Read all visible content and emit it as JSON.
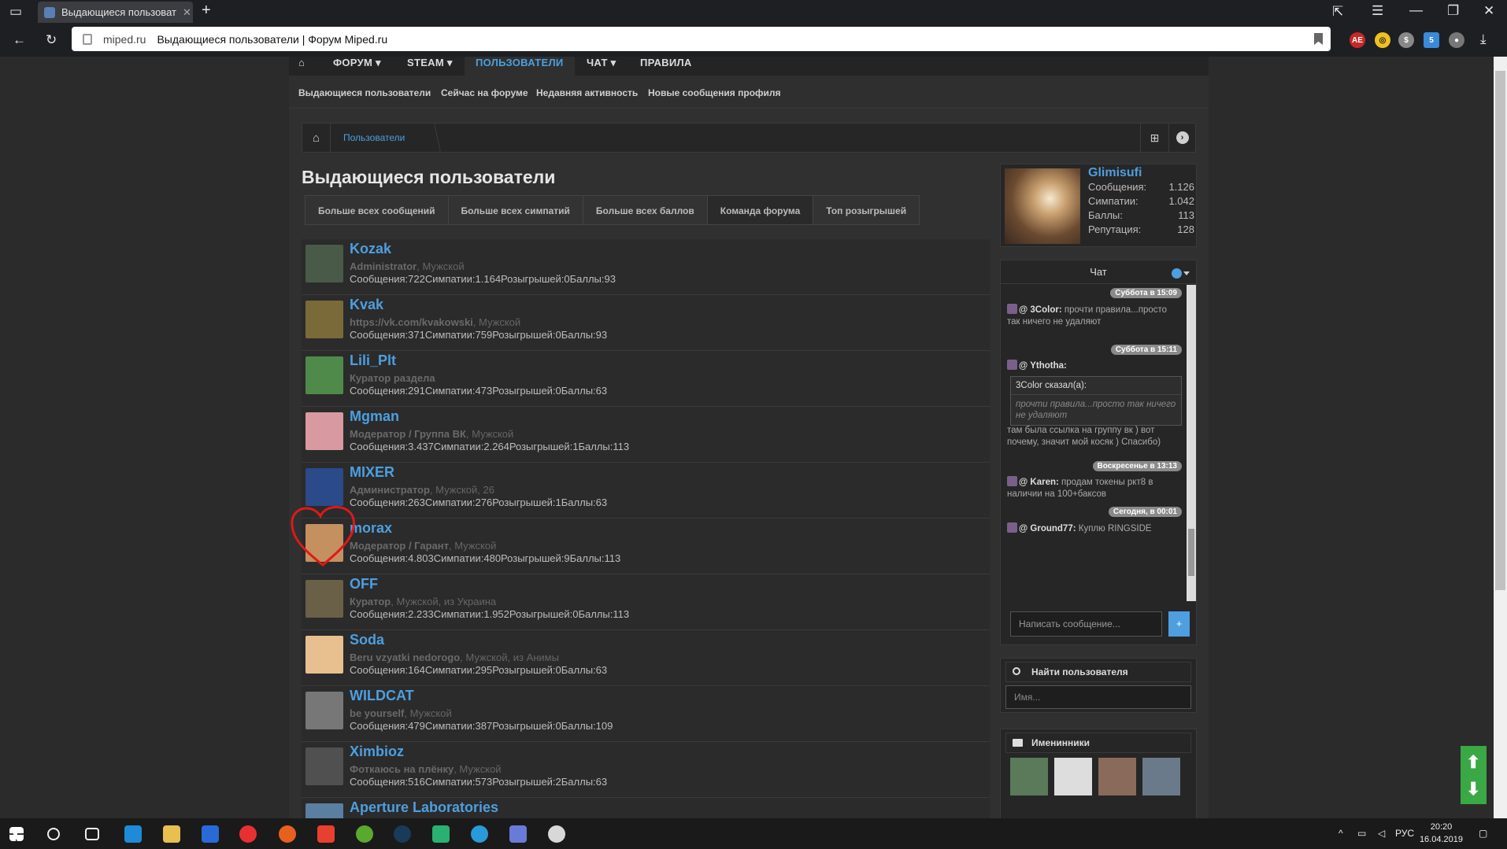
{
  "browser": {
    "tab_title": "Выдающиеся пользоват",
    "domain": "miped.ru",
    "page_title": "Выдающиеся пользователи | Форум Miped.ru"
  },
  "nav": {
    "forum": "ФОРУМ ▾",
    "steam": "STEAM ▾",
    "users": "ПОЛЬЗОВАТЕЛИ",
    "chat": "ЧАТ ▾",
    "rules": "ПРАВИЛА"
  },
  "subnav": [
    "Выдающиеся пользователи",
    "Сейчас на форуме",
    "Недавняя активность",
    "Новые сообщения профиля"
  ],
  "breadcrumb": {
    "item": "Пользователи"
  },
  "page_heading": "Выдающиеся пользователи",
  "tabs": [
    "Больше всех сообщений",
    "Больше всех симпатий",
    "Больше всех баллов",
    "Команда форума",
    "Топ розыгрышей"
  ],
  "members": [
    {
      "name": "Kozak",
      "title": "Administrator",
      "extra": ", Мужской",
      "stats": "Сообщения:722Симпатии:1.164Розыгрышей:0Баллы:93",
      "color": "#4a5a48"
    },
    {
      "name": "Kvak",
      "title": "https://vk.com/kvakowski",
      "extra": ", Мужской",
      "stats": "Сообщения:371Симпатии:759Розыгрышей:0Баллы:93",
      "color": "#7a6a3a"
    },
    {
      "name": "Lili_Plt",
      "title": "Куратор раздела",
      "extra": "",
      "stats": "Сообщения:291Симпатии:473Розыгрышей:0Баллы:63",
      "color": "#4f8a4a"
    },
    {
      "name": "Mgman",
      "title": "Модератор / Группа ВК",
      "extra": ", Мужской",
      "stats": "Сообщения:3.437Симпатии:2.264Розыгрышей:1Баллы:113",
      "color": "#d89aa0"
    },
    {
      "name": "MIXER",
      "title": "Администратор",
      "extra": ", Мужской, 26",
      "stats": "Сообщения:263Симпатии:276Розыгрышей:1Баллы:63",
      "color": "#2a4a8a"
    },
    {
      "name": "morax",
      "title": "Модератор / Гарант",
      "extra": ", Мужской",
      "stats": "Сообщения:4.803Симпатии:480Розыгрышей:9Баллы:113",
      "color": "#c49060"
    },
    {
      "name": "OFF",
      "title": "Куратор",
      "extra": ", Мужской, из Украина",
      "stats": "Сообщения:2.233Симпатии:1.952Розыгрышей:0Баллы:113",
      "color": "#6a6048"
    },
    {
      "name": "Soda",
      "title": "Beru vzyatki nedorogo",
      "extra": ", Мужской, из Анимы",
      "stats": "Сообщения:164Симпатии:295Розыгрышей:0Баллы:63",
      "color": "#e8c090"
    },
    {
      "name": "WILDCAT",
      "title": "be yourself",
      "extra": ", Мужской",
      "stats": "Сообщения:479Симпатии:387Розыгрышей:0Баллы:109",
      "color": "#777777"
    },
    {
      "name": "Ximbioz",
      "title": "Фоткаюсь на плёнку",
      "extra": ", Мужской",
      "stats": "Сообщения:516Симпатии:573Розыгрышей:2Баллы:63",
      "color": "#505050"
    },
    {
      "name": "Aperture Laboratories",
      "title": "",
      "extra": "",
      "stats": "",
      "color": "#5a7fa0"
    }
  ],
  "visitor": {
    "name": "Glimisufi",
    "stats": [
      {
        "label": "Сообщения:",
        "value": "1.126"
      },
      {
        "label": "Симпатии:",
        "value": "1.042"
      },
      {
        "label": "Баллы:",
        "value": "113"
      },
      {
        "label": "Репутация:",
        "value": "128"
      }
    ]
  },
  "chat": {
    "header": "Чат",
    "dates": [
      "Суббота в 15:09",
      "Суббота в 15:11",
      "Воскресенье в 13:13",
      "Сегодня, в 00:01"
    ],
    "messages": [
      {
        "user": "@ 3Color:",
        "text": " прочти правила...просто так ничего не удаляют"
      },
      {
        "user": "@ Ythotha:",
        "text": ""
      },
      {
        "user": "@ Karen:",
        "text": " продам токены ркт8 в наличии на 100+баксов"
      },
      {
        "user": "@ Ground77:",
        "text": " Куплю RINGSIDE"
      }
    ],
    "quote_head": "3Color сказал(а):",
    "quote_body": "прочти правила...просто так ничего не удаляют",
    "reply_text": "там была ссылка на группу вк ) вот почему, значит мой косяк ) Спасибо)",
    "input_placeholder": "Написать сообщение...",
    "send": "+"
  },
  "find_user": {
    "title": "Найти пользователя",
    "placeholder": "Имя..."
  },
  "birthdays": {
    "title": "Именинники"
  },
  "taskbar": {
    "lang": "РУС",
    "time": "20:20",
    "date": "16.04.2019"
  }
}
